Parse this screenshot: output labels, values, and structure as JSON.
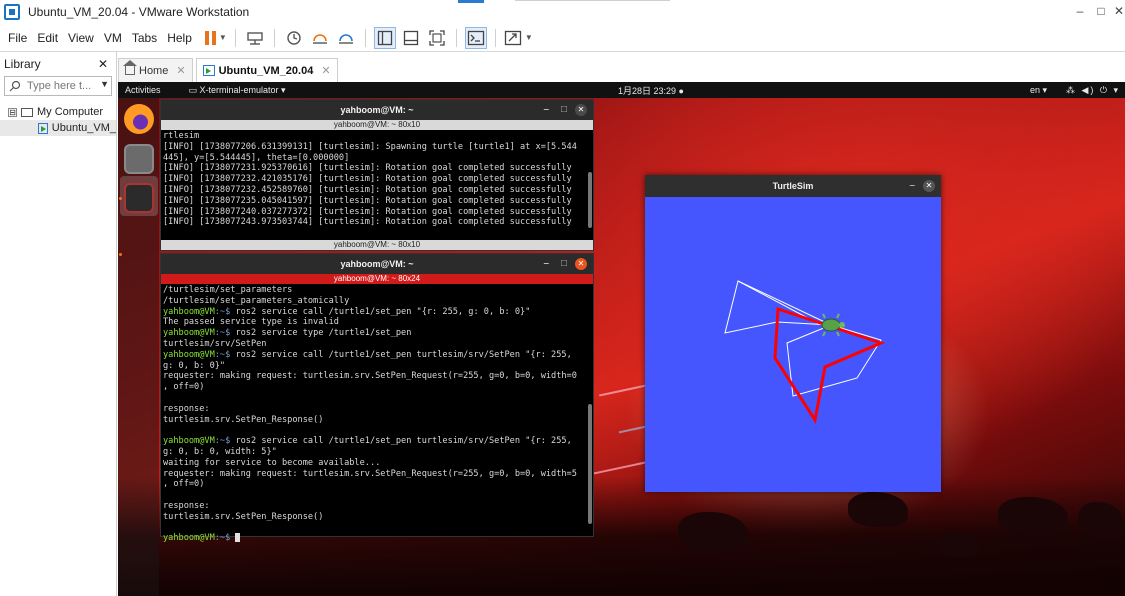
{
  "host": {
    "window_title": "Ubuntu_VM_20.04 - VMware Workstation",
    "minimize": "–",
    "maximize": "□",
    "close": "✕",
    "menus": [
      "File",
      "Edit",
      "View",
      "VM",
      "Tabs",
      "Help"
    ]
  },
  "library": {
    "title": "Library",
    "close": "✕",
    "search_placeholder": "Type here t...",
    "tree": {
      "root_label": "My Computer",
      "toggle": "⊟",
      "vm_label": "Ubuntu_VM_"
    }
  },
  "tabs": [
    {
      "label": "Home",
      "close": "✕"
    },
    {
      "label": "Ubuntu_VM_20.04",
      "close": "✕"
    }
  ],
  "guest": {
    "topbar": {
      "activities": "Activities",
      "app_menu": "▭ X-terminal-emulator ▾",
      "clock": "1月28日 23:29 ●",
      "lang": "en ▾",
      "sys_icons": "⁂ ◀) ⏻ ▾"
    },
    "dock_grid": "⋯"
  },
  "terminal_top": {
    "title": "yahboom@VM: ~",
    "subtitle": "yahboom@VM: ~ 80x10",
    "minimize": "–",
    "maximize": "□",
    "close": "✕",
    "lines": [
      "rtlesim",
      "[INFO] [1738077206.631399131] [turtlesim]: Spawning turtle [turtle1] at x=[5.544",
      "445], y=[5.544445], theta=[0.000000]",
      "[INFO] [1738077231.925370616] [turtlesim]: Rotation goal completed successfully",
      "[INFO] [1738077232.421035176] [turtlesim]: Rotation goal completed successfully",
      "[INFO] [1738077232.452589760] [turtlesim]: Rotation goal completed successfully",
      "[INFO] [1738077235.045041597] [turtlesim]: Rotation goal completed successfully",
      "[INFO] [1738077240.037277372] [turtlesim]: Rotation goal completed successfully",
      "[INFO] [1738077243.973503744] [turtlesim]: Rotation goal completed successfully"
    ],
    "bottom_tab": "yahboom@VM: ~ 80x10"
  },
  "terminal_main": {
    "title": "yahboom@VM: ~",
    "subtitle": "yahboom@VM: ~ 80x24",
    "minimize": "–",
    "maximize": "□",
    "close": "✕",
    "prompt_user": "yahboom@VM",
    "prompt_path": ":~$",
    "lines": [
      {
        "text": "/turtlesim/set_parameters"
      },
      {
        "text": "/turtlesim/set_parameters_atomically"
      },
      {
        "prompt": true,
        "text": " ros2 service call /turtle1/set_pen \"{r: 255, g: 0, b: 0}\""
      },
      {
        "text": "The passed service type is invalid"
      },
      {
        "prompt": true,
        "text": " ros2 service type /turtle1/set_pen"
      },
      {
        "text": "turtlesim/srv/SetPen"
      },
      {
        "prompt": true,
        "text": " ros2 service call /turtle1/set_pen turtlesim/srv/SetPen \"{r: 255,"
      },
      {
        "text": "g: 0, b: 0}\""
      },
      {
        "text": "requester: making request: turtlesim.srv.SetPen_Request(r=255, g=0, b=0, width=0"
      },
      {
        "text": ", off=0)"
      },
      {
        "text": ""
      },
      {
        "text": "response:"
      },
      {
        "text": "turtlesim.srv.SetPen_Response()"
      },
      {
        "text": ""
      },
      {
        "prompt": true,
        "text": " ros2 service call /turtle1/set_pen turtlesim/srv/SetPen \"{r: 255,"
      },
      {
        "text": "g: 0, b: 0, width: 5}\""
      },
      {
        "text": "waiting for service to become available..."
      },
      {
        "text": "requester: making request: turtlesim.srv.SetPen_Request(r=255, g=0, b=0, width=5"
      },
      {
        "text": ", off=0)"
      },
      {
        "text": ""
      },
      {
        "text": "response:"
      },
      {
        "text": "turtlesim.srv.SetPen_Response()"
      },
      {
        "text": ""
      },
      {
        "prompt": true,
        "text": " ",
        "cursor": true
      }
    ]
  },
  "turtlesim": {
    "title": "TurtleSim",
    "minimize": "–",
    "close": "✕",
    "background": "#4556ff"
  },
  "colors": {
    "accent": "#2a7ad1",
    "pause_orange": "#e8731a",
    "ubuntu_orange": "#e95420",
    "prompt_green": "#8ae234",
    "prompt_blue": "#729fcf",
    "pen_red": "#ff0000",
    "pen_white": "#ffffff"
  }
}
